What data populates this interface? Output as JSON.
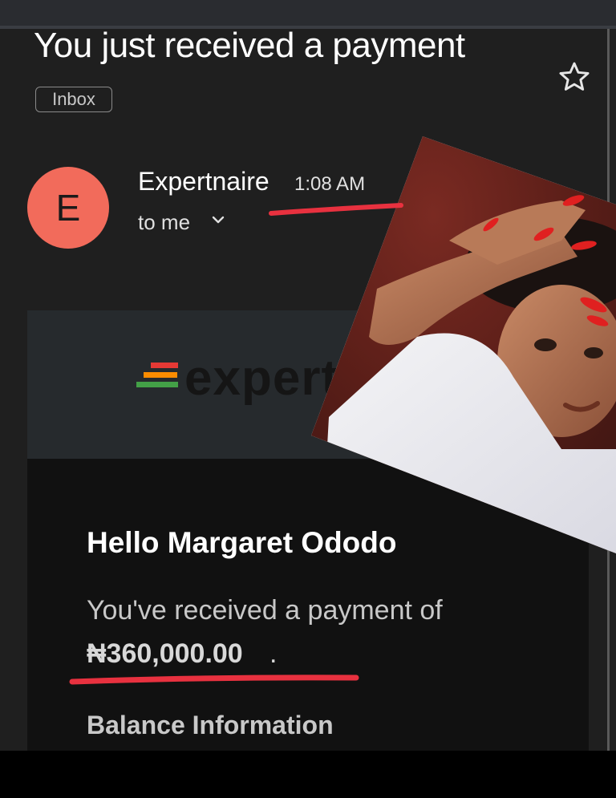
{
  "email": {
    "subject": "You just received a payment",
    "label_chip": "Inbox",
    "sender": {
      "avatar_letter": "E",
      "avatar_color": "#f26b5b",
      "name": "Expertnaire",
      "time": "1:08 AM",
      "recipient": "to me"
    },
    "banner": {
      "logo_text": "expert",
      "logo_colors": [
        "#e53935",
        "#fb8c00",
        "#43a047"
      ]
    },
    "body": {
      "greeting": "Hello Margaret Ododo",
      "payment_intro": "You've received a payment of",
      "amount": "₦360,000.00",
      "amount_suffix": ".",
      "section_heading": "Balance Information"
    }
  },
  "icons": {
    "star": "star-icon",
    "chevron": "chevron-down-icon"
  },
  "annotation_color": "#e8313f",
  "overlay_photo": "photo of a smiling woman with red nails, hands raised to her forehead"
}
